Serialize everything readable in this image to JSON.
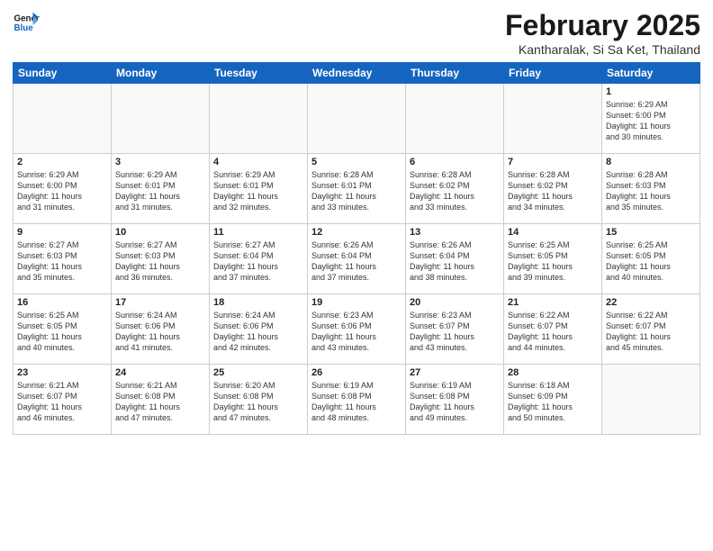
{
  "header": {
    "logo_line1": "General",
    "logo_line2": "Blue",
    "month": "February 2025",
    "location": "Kantharalak, Si Sa Ket, Thailand"
  },
  "days_of_week": [
    "Sunday",
    "Monday",
    "Tuesday",
    "Wednesday",
    "Thursday",
    "Friday",
    "Saturday"
  ],
  "weeks": [
    [
      {
        "day": "",
        "info": ""
      },
      {
        "day": "",
        "info": ""
      },
      {
        "day": "",
        "info": ""
      },
      {
        "day": "",
        "info": ""
      },
      {
        "day": "",
        "info": ""
      },
      {
        "day": "",
        "info": ""
      },
      {
        "day": "1",
        "info": "Sunrise: 6:29 AM\nSunset: 6:00 PM\nDaylight: 11 hours\nand 30 minutes."
      }
    ],
    [
      {
        "day": "2",
        "info": "Sunrise: 6:29 AM\nSunset: 6:00 PM\nDaylight: 11 hours\nand 31 minutes."
      },
      {
        "day": "3",
        "info": "Sunrise: 6:29 AM\nSunset: 6:01 PM\nDaylight: 11 hours\nand 31 minutes."
      },
      {
        "day": "4",
        "info": "Sunrise: 6:29 AM\nSunset: 6:01 PM\nDaylight: 11 hours\nand 32 minutes."
      },
      {
        "day": "5",
        "info": "Sunrise: 6:28 AM\nSunset: 6:01 PM\nDaylight: 11 hours\nand 33 minutes."
      },
      {
        "day": "6",
        "info": "Sunrise: 6:28 AM\nSunset: 6:02 PM\nDaylight: 11 hours\nand 33 minutes."
      },
      {
        "day": "7",
        "info": "Sunrise: 6:28 AM\nSunset: 6:02 PM\nDaylight: 11 hours\nand 34 minutes."
      },
      {
        "day": "8",
        "info": "Sunrise: 6:28 AM\nSunset: 6:03 PM\nDaylight: 11 hours\nand 35 minutes."
      }
    ],
    [
      {
        "day": "9",
        "info": "Sunrise: 6:27 AM\nSunset: 6:03 PM\nDaylight: 11 hours\nand 35 minutes."
      },
      {
        "day": "10",
        "info": "Sunrise: 6:27 AM\nSunset: 6:03 PM\nDaylight: 11 hours\nand 36 minutes."
      },
      {
        "day": "11",
        "info": "Sunrise: 6:27 AM\nSunset: 6:04 PM\nDaylight: 11 hours\nand 37 minutes."
      },
      {
        "day": "12",
        "info": "Sunrise: 6:26 AM\nSunset: 6:04 PM\nDaylight: 11 hours\nand 37 minutes."
      },
      {
        "day": "13",
        "info": "Sunrise: 6:26 AM\nSunset: 6:04 PM\nDaylight: 11 hours\nand 38 minutes."
      },
      {
        "day": "14",
        "info": "Sunrise: 6:25 AM\nSunset: 6:05 PM\nDaylight: 11 hours\nand 39 minutes."
      },
      {
        "day": "15",
        "info": "Sunrise: 6:25 AM\nSunset: 6:05 PM\nDaylight: 11 hours\nand 40 minutes."
      }
    ],
    [
      {
        "day": "16",
        "info": "Sunrise: 6:25 AM\nSunset: 6:05 PM\nDaylight: 11 hours\nand 40 minutes."
      },
      {
        "day": "17",
        "info": "Sunrise: 6:24 AM\nSunset: 6:06 PM\nDaylight: 11 hours\nand 41 minutes."
      },
      {
        "day": "18",
        "info": "Sunrise: 6:24 AM\nSunset: 6:06 PM\nDaylight: 11 hours\nand 42 minutes."
      },
      {
        "day": "19",
        "info": "Sunrise: 6:23 AM\nSunset: 6:06 PM\nDaylight: 11 hours\nand 43 minutes."
      },
      {
        "day": "20",
        "info": "Sunrise: 6:23 AM\nSunset: 6:07 PM\nDaylight: 11 hours\nand 43 minutes."
      },
      {
        "day": "21",
        "info": "Sunrise: 6:22 AM\nSunset: 6:07 PM\nDaylight: 11 hours\nand 44 minutes."
      },
      {
        "day": "22",
        "info": "Sunrise: 6:22 AM\nSunset: 6:07 PM\nDaylight: 11 hours\nand 45 minutes."
      }
    ],
    [
      {
        "day": "23",
        "info": "Sunrise: 6:21 AM\nSunset: 6:07 PM\nDaylight: 11 hours\nand 46 minutes."
      },
      {
        "day": "24",
        "info": "Sunrise: 6:21 AM\nSunset: 6:08 PM\nDaylight: 11 hours\nand 47 minutes."
      },
      {
        "day": "25",
        "info": "Sunrise: 6:20 AM\nSunset: 6:08 PM\nDaylight: 11 hours\nand 47 minutes."
      },
      {
        "day": "26",
        "info": "Sunrise: 6:19 AM\nSunset: 6:08 PM\nDaylight: 11 hours\nand 48 minutes."
      },
      {
        "day": "27",
        "info": "Sunrise: 6:19 AM\nSunset: 6:08 PM\nDaylight: 11 hours\nand 49 minutes."
      },
      {
        "day": "28",
        "info": "Sunrise: 6:18 AM\nSunset: 6:09 PM\nDaylight: 11 hours\nand 50 minutes."
      },
      {
        "day": "",
        "info": ""
      }
    ]
  ]
}
